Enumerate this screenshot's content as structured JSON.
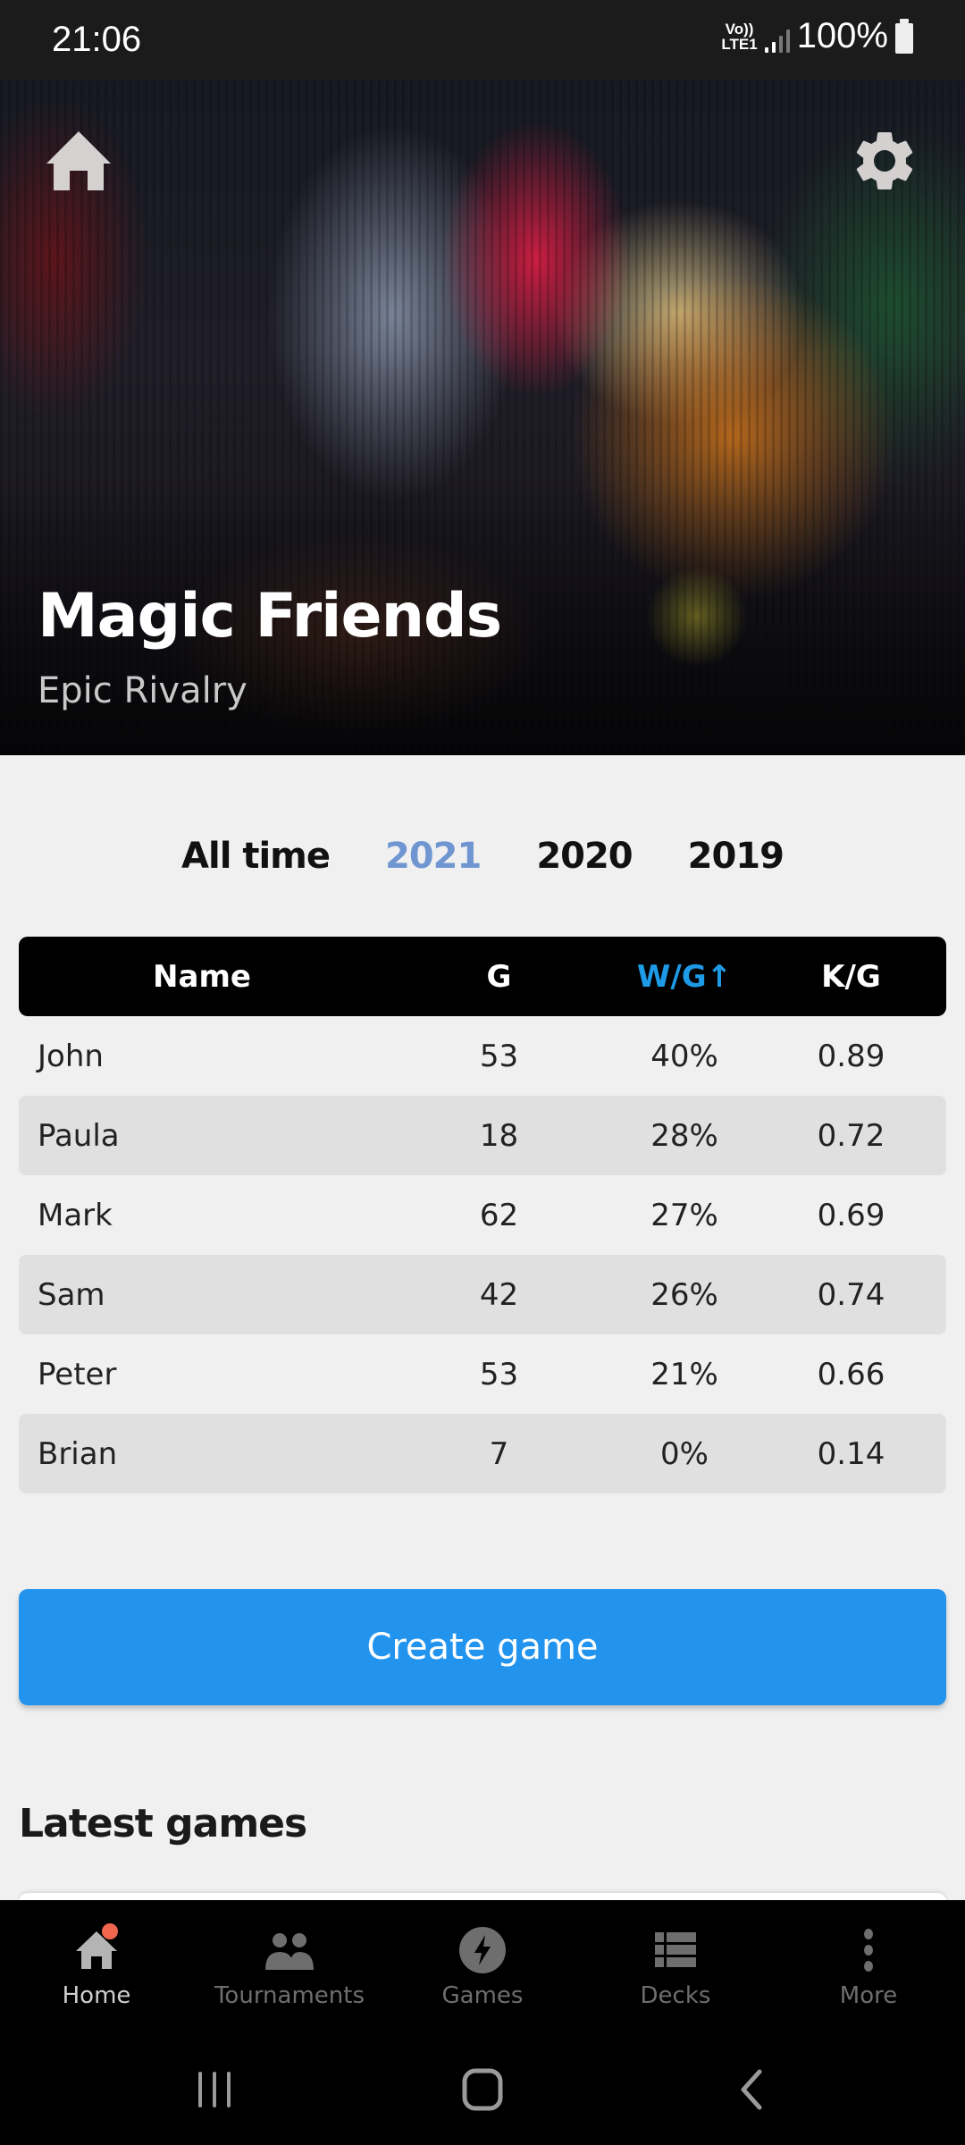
{
  "status_bar": {
    "time": "21:06",
    "network_top": "Vo))",
    "network_bottom": "LTE1",
    "battery_percent": "100%"
  },
  "hero": {
    "title": "Magic Friends",
    "subtitle": "Epic Rivalry",
    "home_icon": "home-icon",
    "settings_icon": "gear-icon"
  },
  "year_tabs": {
    "items": [
      {
        "label": "All time",
        "active": false
      },
      {
        "label": "2021",
        "active": true
      },
      {
        "label": "2020",
        "active": false
      },
      {
        "label": "2019",
        "active": false
      }
    ]
  },
  "stats_table": {
    "columns": [
      {
        "label": "Name"
      },
      {
        "label": "G"
      },
      {
        "label": "W/G↑",
        "sorted": "ascending-arrow"
      },
      {
        "label": "K/G"
      }
    ],
    "rows": [
      {
        "name": "John",
        "g": "53",
        "wg": "40%",
        "kg": "0.89"
      },
      {
        "name": "Paula",
        "g": "18",
        "wg": "28%",
        "kg": "0.72"
      },
      {
        "name": "Mark",
        "g": "62",
        "wg": "27%",
        "kg": "0.69"
      },
      {
        "name": "Sam",
        "g": "42",
        "wg": "26%",
        "kg": "0.74"
      },
      {
        "name": "Peter",
        "g": "53",
        "wg": "21%",
        "kg": "0.66"
      },
      {
        "name": "Brian",
        "g": "7",
        "wg": "0%",
        "kg": "0.14"
      }
    ]
  },
  "create_button": {
    "label": "Create game"
  },
  "latest_games": {
    "title": "Latest games"
  },
  "bottom_nav": {
    "items": [
      {
        "label": "Home",
        "icon": "home-icon",
        "active": true,
        "badge": true
      },
      {
        "label": "Tournaments",
        "icon": "people-icon",
        "active": false
      },
      {
        "label": "Games",
        "icon": "lightning-icon",
        "active": false
      },
      {
        "label": "Decks",
        "icon": "list-icon",
        "active": false
      },
      {
        "label": "More",
        "icon": "more-vertical-icon",
        "active": false
      }
    ]
  },
  "colors": {
    "accent_tab": "#6f96d1",
    "sorted_header": "#1e9be6",
    "create_button": "#2394ee",
    "badge": "#f0664f"
  }
}
